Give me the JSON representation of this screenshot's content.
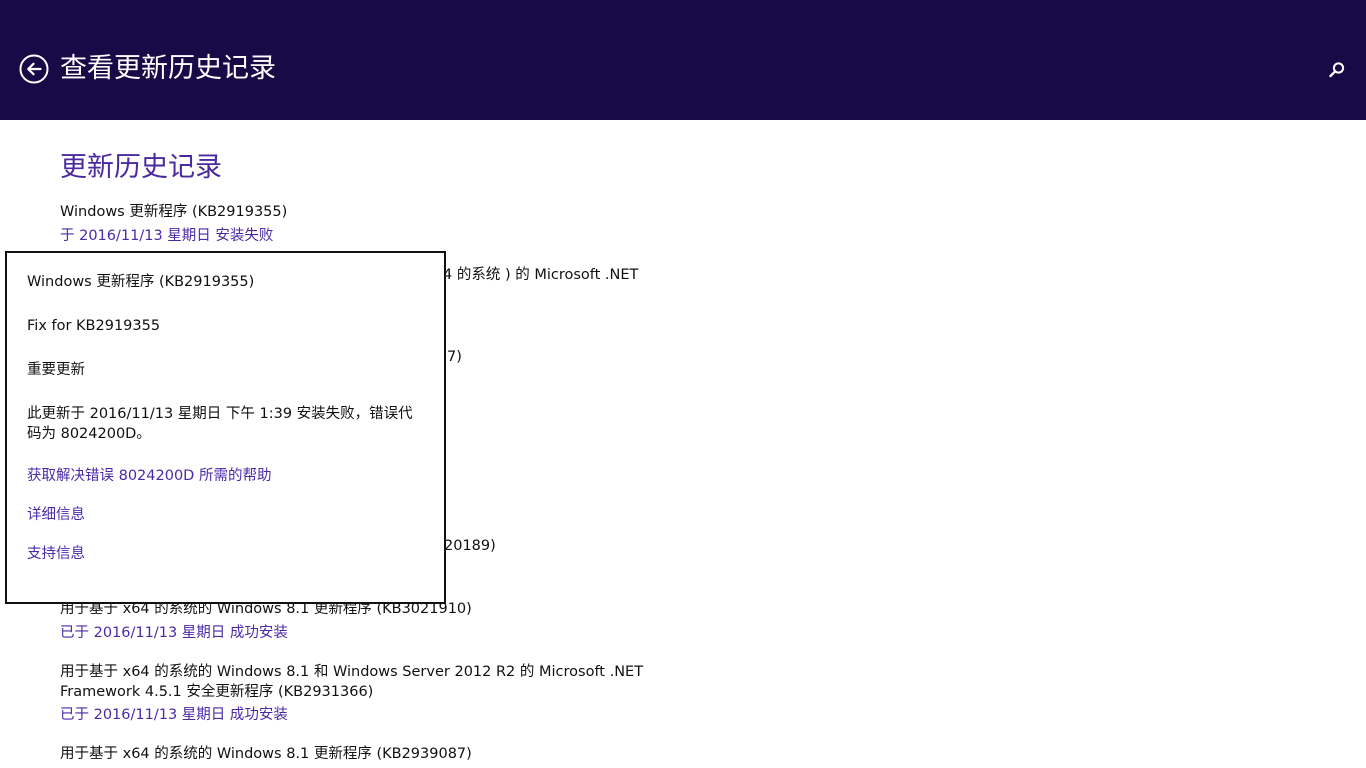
{
  "header": {
    "title": "查看更新历史记录",
    "back_icon": "back-arrow-icon",
    "search_icon": "search-icon"
  },
  "main": {
    "section_title": "更新历史记录",
    "updates": [
      {
        "name": "Windows 更新程序 (KB2919355)",
        "status": "于 2016/11/13 星期日 安装失败"
      },
      {
        "name": "4 的系统 ) 的 Microsoft .NET",
        "status": ""
      },
      {
        "name": "7)",
        "status": ""
      },
      {
        "name": "20189)",
        "status": ""
      },
      {
        "name": "用于基于 x64 的系统的 Windows 8.1 更新程序 (KB3021910)",
        "status": "已于 2016/11/13 星期日 成功安装"
      },
      {
        "name": "用于基于 x64 的系统的 Windows 8.1 和 Windows Server 2012 R2 的 Microsoft .NET Framework 4.5.1 安全更新程序 (KB2931366)",
        "status": "已于 2016/11/13 星期日 成功安装"
      },
      {
        "name": "用于基于 x64 的系统的 Windows 8.1 更新程序 (KB2939087)",
        "status": ""
      }
    ]
  },
  "popup": {
    "title": "Windows 更新程序 (KB2919355)",
    "description": "Fix for KB2919355",
    "type": "重要更新",
    "message": "此更新于 2016/11/13 星期日 下午 1:39 安装失败，错误代码为 8024200D。",
    "help_link": "获取解决错误 8024200D 所需的帮助",
    "details_link": "详细信息",
    "support_link": "支持信息"
  },
  "colors": {
    "header_bg": "#180a47",
    "accent": "#4b2aa8",
    "text": "#111111"
  }
}
